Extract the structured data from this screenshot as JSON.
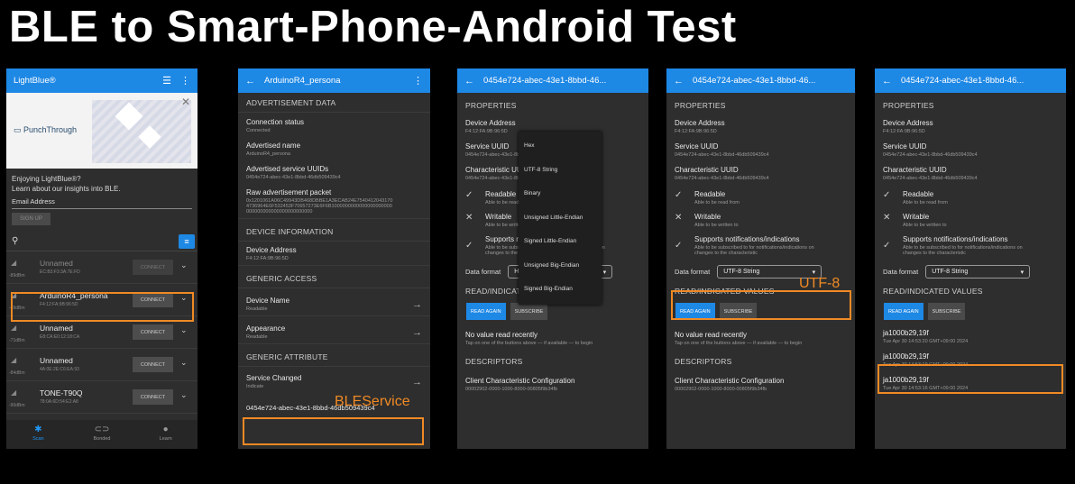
{
  "slide_title": "BLE to Smart-Phone-Android Test",
  "phone1": {
    "app_title": "LightBlue®",
    "ad_logo": "PunchThrough",
    "promo_line1": "Enjoying LightBlue®?",
    "promo_line2": "Learn about our insights into BLE.",
    "email_label": "Email Address",
    "signup_label": "SIGN UP",
    "devices": [
      {
        "name": "Unnamed",
        "mac": "EC:B3:F3:3A:7E:FD",
        "rssi": "-89dBm",
        "button": "CONNECT"
      },
      {
        "name": "ArduinoR4_persona",
        "mac": "F4:12:FA:9B:96:5D",
        "rssi": "-49dBm",
        "button": "CONNECT"
      },
      {
        "name": "Unnamed",
        "mac": "E8:CA:E0:12:18:CA",
        "rssi": "-71dBm",
        "button": "CONNECT"
      },
      {
        "name": "Unnamed",
        "mac": "4A:0E:2E:C6:EA:93",
        "rssi": "-84dBm",
        "button": "CONNECT"
      },
      {
        "name": "TONE-T90Q",
        "mac": "78:0A:6D:54:E2:A8",
        "rssi": "-90dBm",
        "button": "CONNECT"
      }
    ],
    "nav": [
      "Scan",
      "Bonded",
      "Learn"
    ]
  },
  "phone2": {
    "title": "ArduinoR4_persona",
    "sec_adv": "ADVERTISEMENT DATA",
    "conn_label": "Connection status",
    "conn_value": "Connected",
    "adv_name_label": "Advertised name",
    "adv_name_value": "ArduinoR4_persona",
    "adv_uuids_label": "Advertised service UUIDs",
    "adv_uuids_value": "0454e724-abec-43e1-8bbd-46db509439c4",
    "raw_label": "Raw advertisement packet",
    "raw_value1": "0x1201061A06C49943DB468DBBE1A3ECAB24E7540412043170",
    "raw_value2": "4736964E6F532453F70657273E6F6B1000000000000000000000",
    "raw_value3": "000000000000000000000000",
    "sec_dev": "DEVICE INFORMATION",
    "dev_addr_label": "Device Address",
    "dev_addr_value": "F4:12:FA:9B:96:5D",
    "sec_gen": "GENERIC ACCESS",
    "dev_name_label": "Device Name",
    "dev_name_value": "Readable",
    "appearance_label": "Appearance",
    "appearance_value": "Readable",
    "sec_attr": "GENERIC ATTRIBUTE",
    "svc_changed_label": "Service Changed",
    "svc_changed_value": "Indicate",
    "uuid_item": "0454e724-abec-43e1-8bbd-46db509439c4",
    "annotation": "BLEService"
  },
  "char_common": {
    "title": "0454e724-abec-43e1-8bbd-46...",
    "properties": "PROPERTIES",
    "dev_addr_label": "Device Address",
    "dev_addr_value": "F4:12:FA:9B:96:5D",
    "svc_uuid_label": "Service UUID",
    "svc_uuid_value": "0454e724-abec-43e1-8bbd-46db509439c4",
    "char_uuid_label": "Characteristic UUID",
    "char_uuid_value": "0454e724-abec-43e1-8bbd-46db509439c4",
    "readable": "Readable",
    "readable_sub": "Able to be read from",
    "writable": "Writable",
    "writable_sub": "Able to be written to",
    "notify": "Supports notifications/indications",
    "notify_sub1": "Able to be subscribed to for notifications/indications on",
    "notify_sub2": "changes to the characteristic",
    "data_format_label": "Data format",
    "read_values": "READ/INDICATED VALUES",
    "read_again": "READ AGAIN",
    "subscribe": "SUBSCRIBE",
    "no_value": "No value read recently",
    "no_value_sub": "Tap on one of the buttons above — if available — to begin",
    "descriptors": "DESCRIPTORS",
    "cccd_label": "Client Characteristic Configuration",
    "cccd_value": "00002902-0000-1000-8000-00805f9b34fb"
  },
  "phone3": {
    "format_value": "Hex",
    "menu_items": [
      "Hex",
      "UTF-8 String",
      "Binary",
      "Unsigned Little-Endian",
      "Signed Little-Endian",
      "Unsigned Big-Endian",
      "Signed Big-Endian"
    ]
  },
  "phone4": {
    "format_value": "UTF-8 String",
    "annotation": "UTF-8"
  },
  "phone5": {
    "format_value": "UTF-8 String",
    "values": [
      {
        "value": "ja1000b29,19f",
        "time": "Tue Apr 30 14:53:20 GMT+09:00 2024"
      },
      {
        "value": "ja1000b29,19f",
        "time": "Tue Apr 30 14:53:19 GMT+09:00 2024"
      },
      {
        "value": "ja1000b29,19f",
        "time": "Tue Apr 30 14:53:16 GMT+09:00 2024"
      }
    ]
  }
}
